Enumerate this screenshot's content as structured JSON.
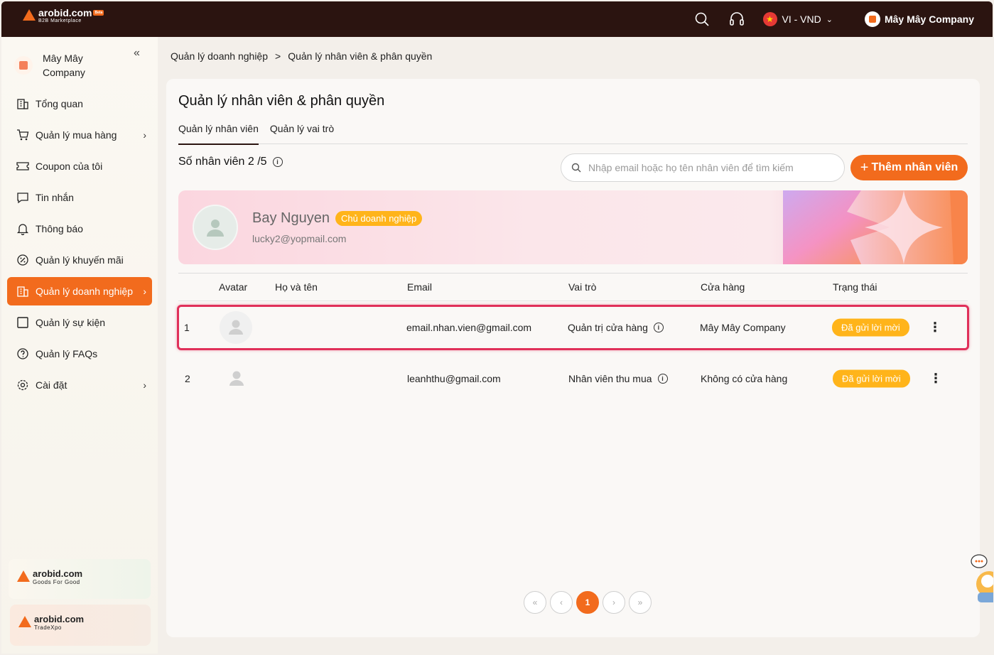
{
  "header": {
    "logo_text": "arobid.com",
    "logo_sub": "B2B Marketplace",
    "logo_badge": "Beta",
    "language": "VI - VND",
    "company": "Mây Mây Company"
  },
  "sidebar": {
    "company_name": "Mây Mây Company",
    "items": [
      {
        "label": "Tổng quan",
        "icon": "building-icon",
        "chevron": false,
        "active": false
      },
      {
        "label": "Quản lý mua hàng",
        "icon": "cart-icon",
        "chevron": true,
        "active": false
      },
      {
        "label": "Coupon của tôi",
        "icon": "coupon-icon",
        "chevron": false,
        "active": false
      },
      {
        "label": "Tin nhắn",
        "icon": "message-icon",
        "chevron": false,
        "active": false
      },
      {
        "label": "Thông báo",
        "icon": "bell-icon",
        "chevron": false,
        "active": false
      },
      {
        "label": "Quản lý khuyến mãi",
        "icon": "discount-icon",
        "chevron": false,
        "active": false
      },
      {
        "label": "Quản lý doanh nghiệp",
        "icon": "building-icon",
        "chevron": true,
        "active": true
      },
      {
        "label": "Quản lý sự kiện",
        "icon": "square-icon",
        "chevron": false,
        "active": false
      },
      {
        "label": "Quản lý FAQs",
        "icon": "question-icon",
        "chevron": false,
        "active": false
      },
      {
        "label": "Cài đặt",
        "icon": "gear-icon",
        "chevron": true,
        "active": false
      }
    ],
    "promo1": {
      "logo": "arobid.com",
      "sub": "Goods For Good"
    },
    "promo2": {
      "logo": "arobid.com",
      "sub": "TradeXpo"
    }
  },
  "breadcrumb": [
    "Quản lý doanh nghiệp",
    ">",
    "Quản lý nhân viên & phân quyền"
  ],
  "main": {
    "title": "Quản lý nhân viên & phân quyền",
    "tabs": [
      {
        "label": "Quản lý nhân viên",
        "active": true
      },
      {
        "label": "Quản lý vai trò",
        "active": false
      }
    ],
    "count_label": "Số nhân viên 2 /5",
    "search_placeholder": "Nhập email hoặc họ tên nhân viên để tìm kiếm",
    "add_button": "Thêm nhân viên",
    "owner": {
      "name": "Bay Nguyen",
      "tag": "Chủ doanh nghiệp",
      "email": "lucky2@yopmail.com"
    },
    "columns": [
      "Avatar",
      "Họ và tên",
      "Email",
      "Vai trò",
      "Cửa hàng",
      "Trạng thái"
    ],
    "rows": [
      {
        "index": "1",
        "name": "",
        "email": "email.nhan.vien@gmail.com",
        "role": "Quản trị cửa hàng",
        "store": "Mây Mây Company",
        "status": "Đã gửi lời mời"
      },
      {
        "index": "2",
        "name": "",
        "email": "leanhthu@gmail.com",
        "role": "Nhân viên thu mua",
        "store": "Không có cửa hàng",
        "status": "Đã gửi lời mời"
      }
    ],
    "pagination": {
      "first": "«",
      "prev": "‹",
      "current": "1",
      "next": "›",
      "last": "»"
    }
  },
  "colors": {
    "accent": "#f26b1d",
    "header_bg": "#2b1410",
    "status": "#ffb41a",
    "highlight": "#e0305a"
  }
}
